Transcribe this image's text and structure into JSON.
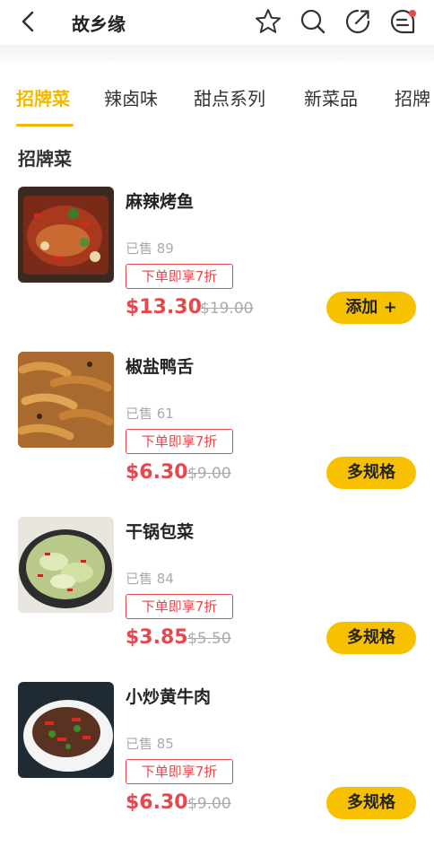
{
  "header": {
    "title": "故乡缘",
    "icons": [
      "back-icon",
      "star-icon",
      "search-icon",
      "share-icon",
      "message-icon"
    ],
    "notification_dot_color": "#e5484d"
  },
  "tabs": [
    {
      "label": "招牌菜",
      "active": true
    },
    {
      "label": "辣卤味",
      "active": false
    },
    {
      "label": "甜点系列",
      "active": false
    },
    {
      "label": "新菜品",
      "active": false
    },
    {
      "label": "招牌",
      "active": false
    }
  ],
  "section": {
    "title": "招牌菜"
  },
  "items": [
    {
      "name": "麻辣烤鱼",
      "sold": "已售 89",
      "promo": "下单即享7折",
      "price": "$13.30",
      "original_price": "$19.00",
      "action": "添加 +"
    },
    {
      "name": "椒盐鸭舌",
      "sold": "已售 61",
      "promo": "下单即享7折",
      "price": "$6.30",
      "original_price": "$9.00",
      "action": "多规格"
    },
    {
      "name": "干锅包菜",
      "sold": "已售 84",
      "promo": "下单即享7折",
      "price": "$3.85",
      "original_price": "$5.50",
      "action": "多规格"
    },
    {
      "name": "小炒黄牛肉",
      "sold": "已售 85",
      "promo": "下单即享7折",
      "price": "$6.30",
      "original_price": "$9.00",
      "action": "多规格"
    }
  ],
  "colors": {
    "accent": "#f5b800",
    "button": "#f7c100",
    "price": "#e5484d"
  }
}
